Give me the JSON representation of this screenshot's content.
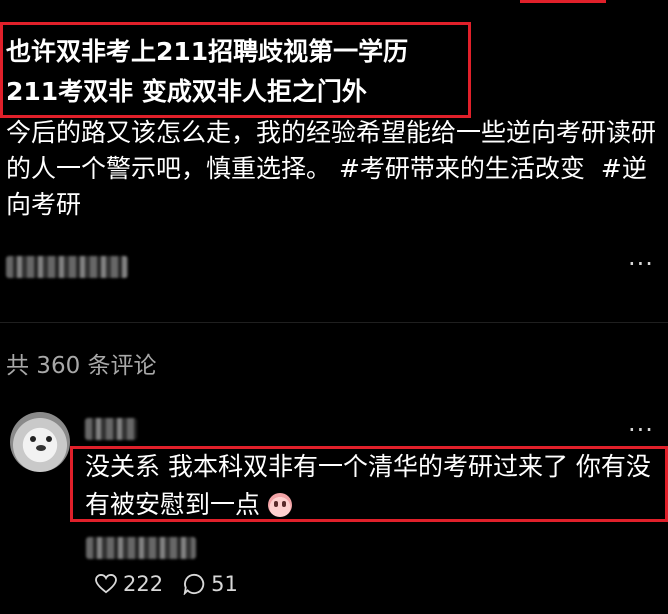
{
  "post": {
    "title_line1": "也许双非考上211招聘歧视第一学历",
    "title_line2": "211考双非 变成双非人拒之门外",
    "body": "今后的路又该怎么走，我的经验希望能给一些逆向考研读研的人一个警示吧，慎重选择。",
    "tags": [
      "#考研带来的生活改变",
      "#逆向考研"
    ],
    "more": "···"
  },
  "comments_header": {
    "count_text": "共 360 条评论"
  },
  "comment": {
    "text": "没关系 我本科双非有一个清华的考研过来了 你有没有被安慰到一点",
    "emoji": "crying-face",
    "more": "···",
    "like_count": "222",
    "reply_count": "51"
  },
  "colors": {
    "highlight": "#e0202a",
    "background": "#000000",
    "secondary_text": "#a8a8a8"
  }
}
